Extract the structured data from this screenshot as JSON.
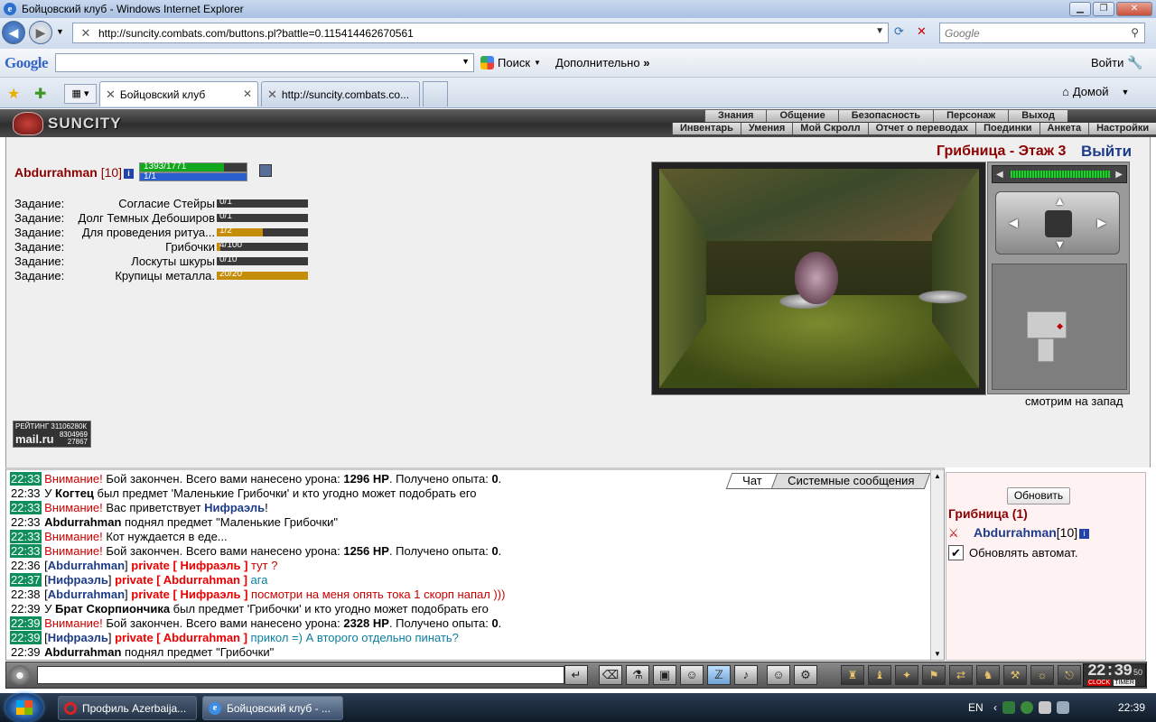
{
  "window": {
    "title": "Бойцовский клуб - Windows Internet Explorer"
  },
  "address": {
    "url": "http://suncity.combats.com/buttons.pl?battle=0.115414462670561",
    "search_placeholder": "Google"
  },
  "google_toolbar": {
    "logo": "Google",
    "search_label": "Поиск",
    "more_label": "Дополнительно",
    "login_label": "Войти"
  },
  "tabs": [
    {
      "label": "Бойцовский клуб",
      "active": true
    },
    {
      "label": "http://suncity.combats.co...",
      "active": false
    }
  ],
  "home_label": "Домой",
  "game": {
    "logo": "SUNCITY",
    "menu_top": [
      "Знания",
      "Общение",
      "Безопасность",
      "Персонаж",
      "Выход"
    ],
    "menu_bottom": [
      "Инвентарь",
      "Умения",
      "Мой Скролл",
      "Отчет о переводах",
      "Поединки",
      "Анкета",
      "Настройки"
    ]
  },
  "character": {
    "name": "Abdurrahman",
    "level": "[10]",
    "hp_text": "1393/1771",
    "hp_fraction": 0.787,
    "mp_text": "1/1",
    "mp_fraction": 1.0
  },
  "quests": [
    {
      "label": "Задание:",
      "name": "Согласие Стейры",
      "progress": "0/1",
      "fraction": 0
    },
    {
      "label": "Задание:",
      "name": "Долг Темных Дебоширов",
      "progress": "0/1",
      "fraction": 0
    },
    {
      "label": "Задание:",
      "name": "Для проведения ритуа...",
      "progress": "1/2",
      "fraction": 0.5
    },
    {
      "label": "Задание:",
      "name": "Грибочки",
      "progress": "4/100",
      "fraction": 0.04
    },
    {
      "label": "Задание:",
      "name": "Лоскуты шкуры",
      "progress": "0/10",
      "fraction": 0
    },
    {
      "label": "Задание:",
      "name": "Крупицы металла.",
      "progress": "20/20",
      "fraction": 1.0
    }
  ],
  "location": {
    "title": "Грибница - Этаж 3",
    "logout": "Выйти",
    "facing": "смотрим на запад"
  },
  "rating": {
    "label": "РЕЙТИНГ",
    "top": "31106280К",
    "brand": "mail.ru",
    "n1": "8304969",
    "n2": "27867"
  },
  "chat_tabs": [
    "Чат",
    "Системные сообщения"
  ],
  "chat": [
    {
      "time": "22:33",
      "hl": true,
      "parts": [
        [
          "warn",
          "Внимание!"
        ],
        [
          "plain",
          " Бой закончен. Всего вами нанесено урона: "
        ],
        [
          "bold",
          "1296 HP"
        ],
        [
          "plain",
          ". Получено опыта: "
        ],
        [
          "bold",
          "0"
        ],
        [
          "plain",
          "."
        ]
      ]
    },
    {
      "time": "22:33",
      "hl": false,
      "parts": [
        [
          "plain",
          "У "
        ],
        [
          "bold",
          "Когтец"
        ],
        [
          "plain",
          " был предмет 'Маленькие Грибочки' и кто угодно может подобрать его"
        ]
      ]
    },
    {
      "time": "22:33",
      "hl": true,
      "parts": [
        [
          "warn",
          "Внимание!"
        ],
        [
          "plain",
          " Вас приветствует "
        ],
        [
          "nick",
          "Нифраэль"
        ],
        [
          "plain",
          "!"
        ]
      ]
    },
    {
      "time": "22:33",
      "hl": false,
      "parts": [
        [
          "bold",
          "Abdurrahman"
        ],
        [
          "plain",
          " поднял предмет \"Маленькие Грибочки\""
        ]
      ]
    },
    {
      "time": "22:33",
      "hl": true,
      "parts": [
        [
          "warn",
          "Внимание!"
        ],
        [
          "plain",
          " Кот нуждается в еде..."
        ]
      ]
    },
    {
      "time": "22:33",
      "hl": true,
      "parts": [
        [
          "warn",
          "Внимание!"
        ],
        [
          "plain",
          " Бой закончен. Всего вами нанесено урона: "
        ],
        [
          "bold",
          "1256 HP"
        ],
        [
          "plain",
          ". Получено опыта: "
        ],
        [
          "bold",
          "0"
        ],
        [
          "plain",
          "."
        ]
      ]
    },
    {
      "time": "22:36",
      "hl": false,
      "parts": [
        [
          "plain",
          "["
        ],
        [
          "nick",
          "Abdurrahman"
        ],
        [
          "plain",
          "] "
        ],
        [
          "priv",
          "private [ Нифраэль ]"
        ],
        [
          "red",
          " тут ?"
        ]
      ]
    },
    {
      "time": "22:37",
      "hl": true,
      "parts": [
        [
          "plain",
          "["
        ],
        [
          "nick",
          "Нифраэль"
        ],
        [
          "plain",
          "] "
        ],
        [
          "priv",
          "private [ Abdurrahman ]"
        ],
        [
          "teal",
          " ага"
        ]
      ]
    },
    {
      "time": "22:38",
      "hl": false,
      "parts": [
        [
          "plain",
          "["
        ],
        [
          "nick",
          "Abdurrahman"
        ],
        [
          "plain",
          "] "
        ],
        [
          "priv",
          "private [ Нифраэль ]"
        ],
        [
          "red",
          " посмотри на меня опять тока 1 скорп напал )))"
        ]
      ]
    },
    {
      "time": "22:39",
      "hl": false,
      "parts": [
        [
          "plain",
          "У "
        ],
        [
          "bold",
          "Брат Скорпиончика"
        ],
        [
          "plain",
          " был предмет 'Грибочки' и кто угодно может подобрать его"
        ]
      ]
    },
    {
      "time": "22:39",
      "hl": true,
      "parts": [
        [
          "warn",
          "Внимание!"
        ],
        [
          "plain",
          " Бой закончен. Всего вами нанесено урона: "
        ],
        [
          "bold",
          "2328 HP"
        ],
        [
          "plain",
          ". Получено опыта: "
        ],
        [
          "bold",
          "0"
        ],
        [
          "plain",
          "."
        ]
      ]
    },
    {
      "time": "22:39",
      "hl": true,
      "parts": [
        [
          "plain",
          "["
        ],
        [
          "nick",
          "Нифраэль"
        ],
        [
          "plain",
          "] "
        ],
        [
          "priv",
          "private [ Abdurrahman ]"
        ],
        [
          "teal",
          " прикол =) А второго отдельно пинать?"
        ]
      ]
    },
    {
      "time": "22:39",
      "hl": false,
      "parts": [
        [
          "bold",
          "Abdurrahman"
        ],
        [
          "plain",
          " поднял предмет \"Грибочки\""
        ]
      ]
    }
  ],
  "right_panel": {
    "refresh": "Обновить",
    "location": "Грибница (1)",
    "member_name": "Abdurrahman",
    "member_level": "[10]",
    "auto_label": "Обновлять автомат."
  },
  "clock": {
    "time": "22:39",
    "sec": "50",
    "label1": "CLOCK",
    "label2": "TIMER"
  },
  "taskbar": {
    "items": [
      "Профиль Azerbaija...",
      "Бойцовский клуб - ..."
    ],
    "lang": "EN",
    "time": "22:39"
  }
}
